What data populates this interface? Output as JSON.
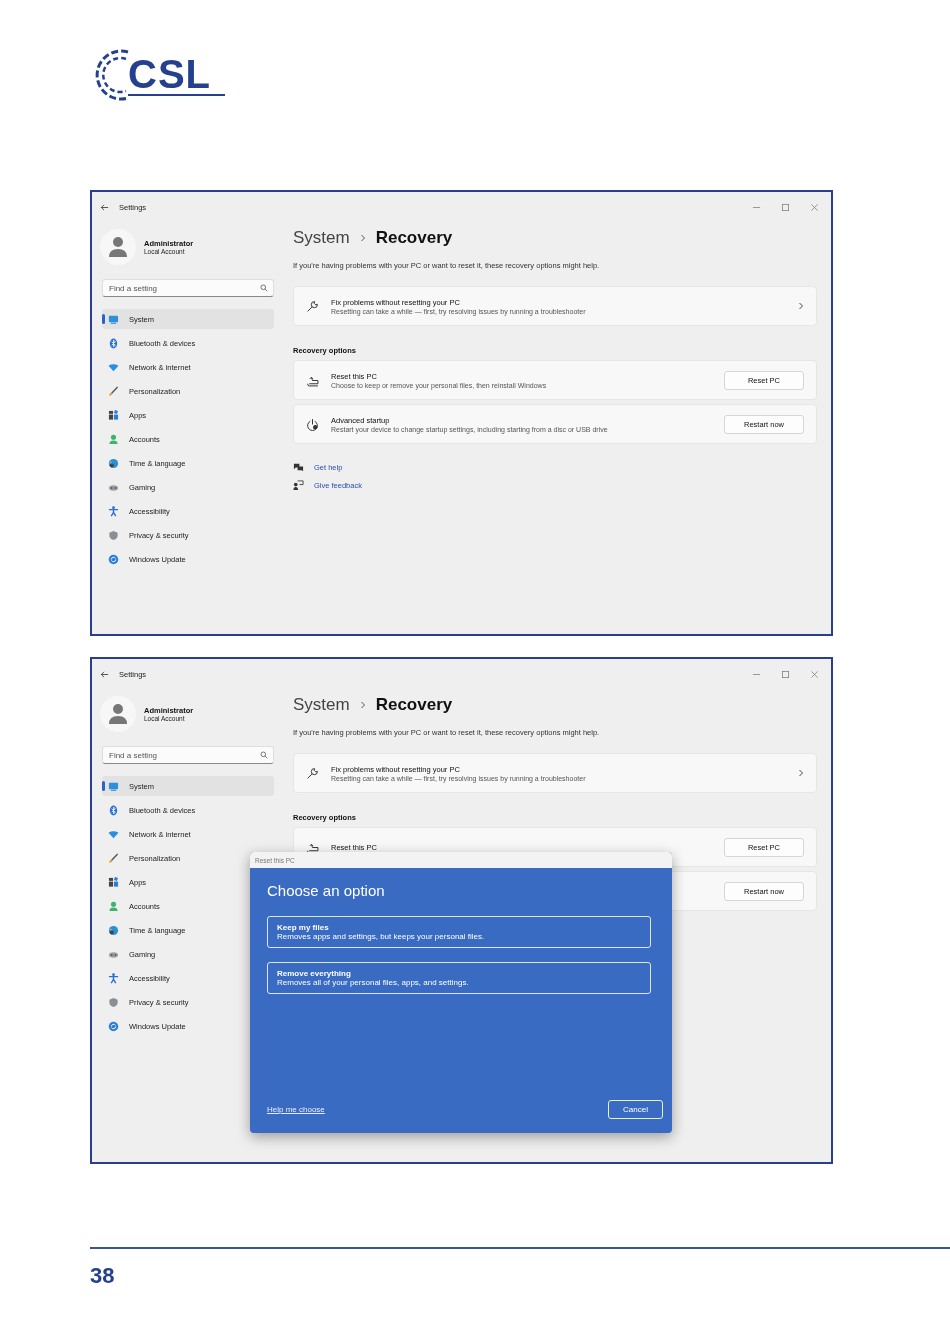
{
  "logo": {
    "text": "CSL"
  },
  "screens": [
    {
      "title": "Settings",
      "account": {
        "name": "Administrator",
        "type": "Local Account"
      },
      "search": {
        "placeholder": "Find a setting"
      },
      "nav": [
        {
          "label": "System",
          "selected": true
        },
        {
          "label": "Bluetooth & devices",
          "selected": false
        },
        {
          "label": "Network & internet",
          "selected": false
        },
        {
          "label": "Personalization",
          "selected": false
        },
        {
          "label": "Apps",
          "selected": false
        },
        {
          "label": "Accounts",
          "selected": false
        },
        {
          "label": "Time & language",
          "selected": false
        },
        {
          "label": "Gaming",
          "selected": false
        },
        {
          "label": "Accessibility",
          "selected": false
        },
        {
          "label": "Privacy & security",
          "selected": false
        },
        {
          "label": "Windows Update",
          "selected": false
        }
      ],
      "breadcrumb": {
        "parent": "System",
        "current": "Recovery"
      },
      "intro": "If you're having problems with your PC or want to reset it, these recovery options might help.",
      "fix": {
        "title": "Fix problems without resetting your PC",
        "description": "Resetting can take a while — first, try resolving issues by running a troubleshooter"
      },
      "section": "Recovery options",
      "options": [
        {
          "title": "Reset this PC",
          "description": "Choose to keep or remove your personal files, then reinstall Windows",
          "button": "Reset PC"
        },
        {
          "title": "Advanced startup",
          "description": "Restart your device to change startup settings, including starting from a disc or USB drive",
          "button": "Restart now"
        }
      ],
      "links": [
        {
          "label": "Get help"
        },
        {
          "label": "Give feedback"
        }
      ]
    },
    {
      "title": "Settings",
      "account": {
        "name": "Administrator",
        "type": "Local Account"
      },
      "search": {
        "placeholder": "Find a setting"
      },
      "nav": [
        {
          "label": "System",
          "selected": true
        },
        {
          "label": "Bluetooth & devices",
          "selected": false
        },
        {
          "label": "Network & internet",
          "selected": false
        },
        {
          "label": "Personalization",
          "selected": false
        },
        {
          "label": "Apps",
          "selected": false
        },
        {
          "label": "Accounts",
          "selected": false
        },
        {
          "label": "Time & language",
          "selected": false
        },
        {
          "label": "Gaming",
          "selected": false
        },
        {
          "label": "Accessibility",
          "selected": false
        },
        {
          "label": "Privacy & security",
          "selected": false
        },
        {
          "label": "Windows Update",
          "selected": false
        }
      ],
      "breadcrumb": {
        "parent": "System",
        "current": "Recovery"
      },
      "intro": "If you're having problems with your PC or want to reset it, these recovery options might help.",
      "fix": {
        "title": "Fix problems without resetting your PC",
        "description": "Resetting can take a while — first, try resolving issues by running a troubleshooter"
      },
      "section": "Recovery options",
      "options": [
        {
          "title": "Reset this PC",
          "button": "Reset PC"
        },
        {
          "button": "Restart now"
        }
      ],
      "dialog": {
        "title": "Reset this PC",
        "heading": "Choose an option",
        "choices": [
          {
            "title": "Keep my files",
            "description": "Removes apps and settings, but keeps your personal files."
          },
          {
            "title": "Remove everything",
            "description": "Removes all of your personal files, apps, and settings."
          }
        ],
        "help_link": "Help me choose",
        "cancel": "Cancel"
      }
    }
  ],
  "page_number": "38"
}
